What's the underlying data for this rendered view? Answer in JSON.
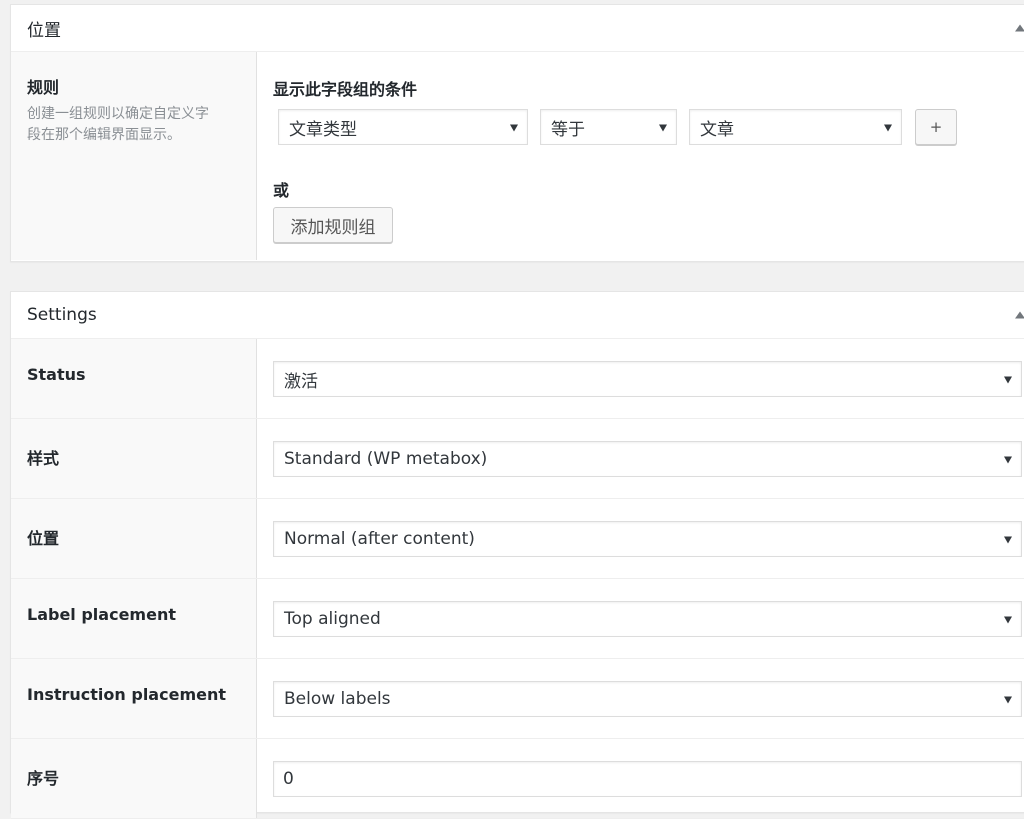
{
  "location_box": {
    "title": "位置",
    "rules": {
      "label": "规则",
      "description_line1": "创建一组规则以确定自定义字",
      "description_line2": "段在那个编辑界面显示。"
    },
    "group_title": "显示此字段组的条件",
    "condition": {
      "param": "文章类型",
      "operator": "等于",
      "value": "文章"
    },
    "plus_label": "+",
    "or_label": "或",
    "add_group_label": "添加规则组"
  },
  "settings_box": {
    "title": "Settings",
    "rows": [
      {
        "label": "Status",
        "value": "激活"
      },
      {
        "label": "样式",
        "value": "Standard (WP metabox)"
      },
      {
        "label": "位置",
        "value": "Normal (after content)"
      },
      {
        "label": "Label placement",
        "value": "Top aligned"
      },
      {
        "label": "Instruction placement",
        "value": "Below labels"
      },
      {
        "label": "序号",
        "value": "0"
      }
    ]
  }
}
